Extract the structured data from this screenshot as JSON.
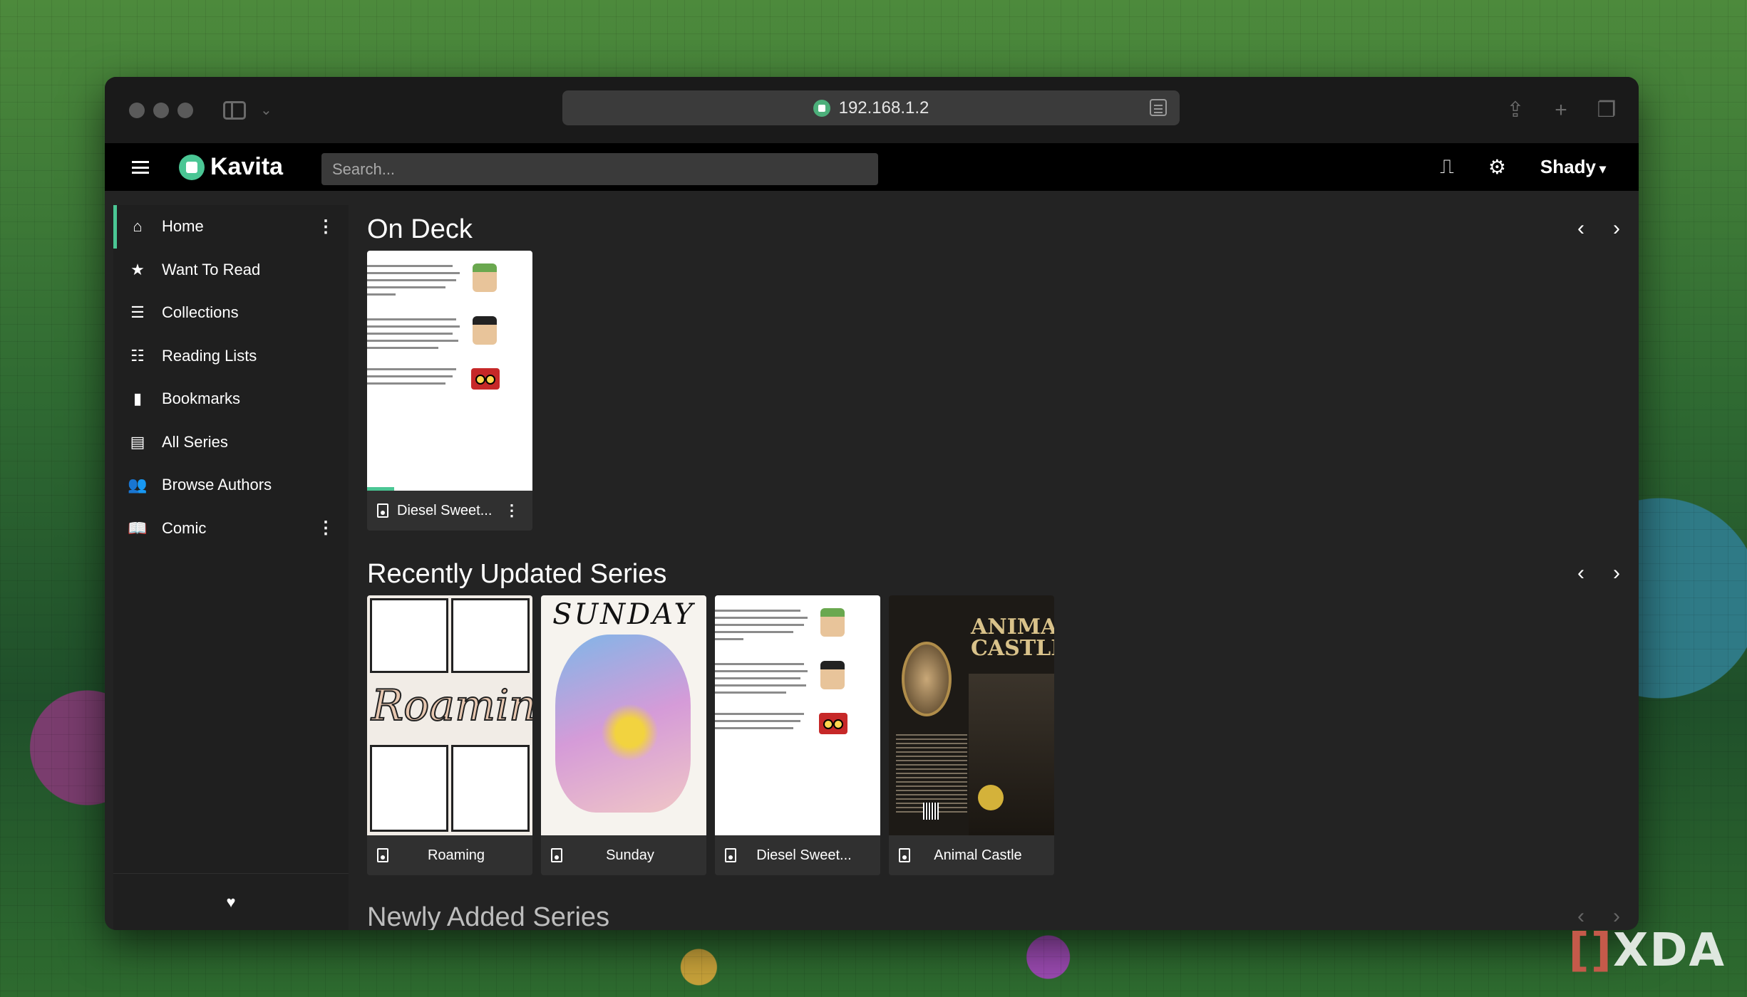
{
  "browser": {
    "url": "192.168.1.2"
  },
  "app": {
    "brand": "Kavita",
    "search_placeholder": "Search...",
    "user": "Shady"
  },
  "sidebar": {
    "items": [
      {
        "label": "Home",
        "icon": "home-icon",
        "active": true,
        "has_menu": true
      },
      {
        "label": "Want To Read",
        "icon": "star-icon",
        "active": false,
        "has_menu": false
      },
      {
        "label": "Collections",
        "icon": "list-icon",
        "active": false,
        "has_menu": false
      },
      {
        "label": "Reading Lists",
        "icon": "ordered-list-icon",
        "active": false,
        "has_menu": false
      },
      {
        "label": "Bookmarks",
        "icon": "bookmark-icon",
        "active": false,
        "has_menu": false
      },
      {
        "label": "All Series",
        "icon": "list-alt-icon",
        "active": false,
        "has_menu": false
      },
      {
        "label": "Browse Authors",
        "icon": "users-icon",
        "active": false,
        "has_menu": false
      },
      {
        "label": "Comic",
        "icon": "book-open-icon",
        "active": false,
        "has_menu": true
      }
    ],
    "accent_color": "#4ac694"
  },
  "sections": {
    "on_deck": {
      "title": "On Deck",
      "cards": [
        {
          "title": "Diesel Sweet...",
          "cover": "text-page",
          "progress_percent": 16
        }
      ]
    },
    "recently_updated": {
      "title": "Recently Updated Series",
      "cards": [
        {
          "title": "Roaming",
          "cover": "roaming"
        },
        {
          "title": "Sunday",
          "cover": "sunday"
        },
        {
          "title": "Diesel Sweet...",
          "cover": "text-page"
        },
        {
          "title": "Animal Castle",
          "cover": "castle"
        }
      ]
    },
    "newly_added": {
      "title": "Newly Added Series"
    }
  },
  "covers": {
    "sunday_title": "SUNDAY",
    "roaming_title": "Roaming",
    "castle_title": "ANIMAL CASTLE"
  },
  "watermark": "XDA"
}
